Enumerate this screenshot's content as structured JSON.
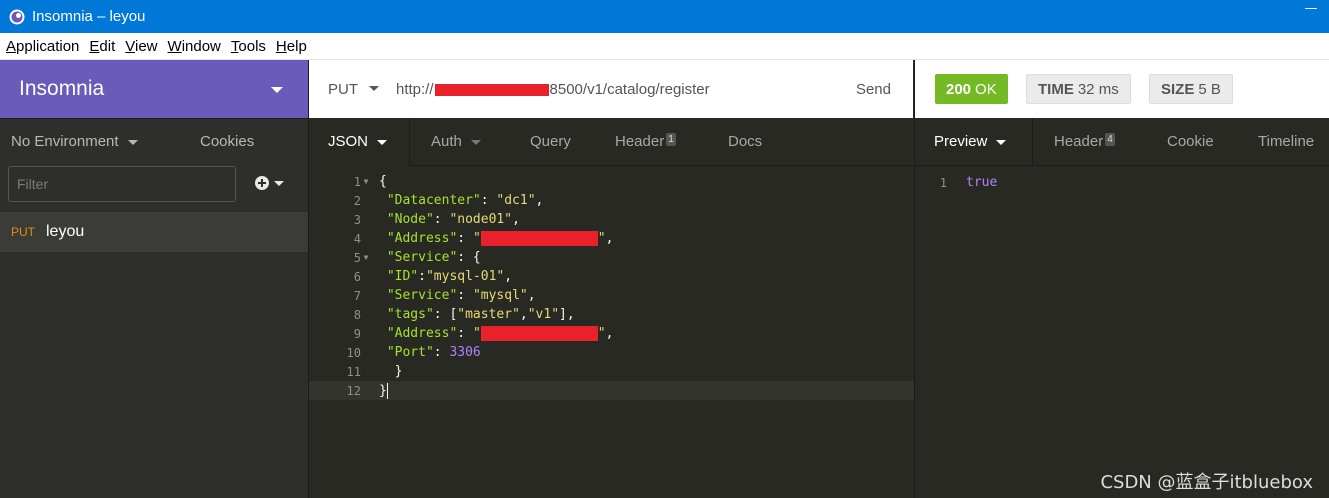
{
  "window": {
    "title": "Insomnia – leyou"
  },
  "menu": [
    "Application",
    "Edit",
    "View",
    "Window",
    "Tools",
    "Help"
  ],
  "sidebar": {
    "workspace": "Insomnia",
    "environment": "No Environment",
    "cookies": "Cookies",
    "filter_placeholder": "Filter",
    "requests": [
      {
        "method": "PUT",
        "name": "leyou"
      }
    ]
  },
  "request": {
    "method": "PUT",
    "url_prefix": "http://",
    "url_suffix": "8500/v1/catalog/register",
    "send": "Send",
    "tabs": {
      "body": "JSON",
      "auth": "Auth",
      "query": "Query",
      "header": "Header",
      "header_count": "1",
      "docs": "Docs"
    }
  },
  "body_lines": {
    "l1": "{",
    "l2k": "\"Datacenter\"",
    "l2v": "\"dc1\"",
    "l3k": "\"Node\"",
    "l3v": "\"node01\"",
    "l4k": "\"Address\"",
    "l5k": "\"Service\"",
    "l6k": "\"ID\"",
    "l6v": "\"mysql-01\"",
    "l7k": "\"Service\"",
    "l7v": "\"mysql\"",
    "l8k": "\"tags\"",
    "l8v1": "\"master\"",
    "l8v2": "\"v1\"",
    "l9k": "\"Address\"",
    "l10k": "\"Port\"",
    "l10v": "3306"
  },
  "response": {
    "status": "200 OK",
    "status_code": "200",
    "status_text": "OK",
    "time_label": "TIME",
    "time_value": "32 ms",
    "size_label": "SIZE",
    "size_value": "5 B",
    "tabs": {
      "preview": "Preview",
      "header": "Header",
      "header_count": "4",
      "cookie": "Cookie",
      "timeline": "Timeline"
    },
    "body": "true"
  },
  "watermark": "CSDN @蓝盒子itbluebox",
  "colors": {
    "accent": "#6a5ab9",
    "titlebar": "#0078d7",
    "status_ok": "#75ba24",
    "method_put": "#e28a19"
  }
}
